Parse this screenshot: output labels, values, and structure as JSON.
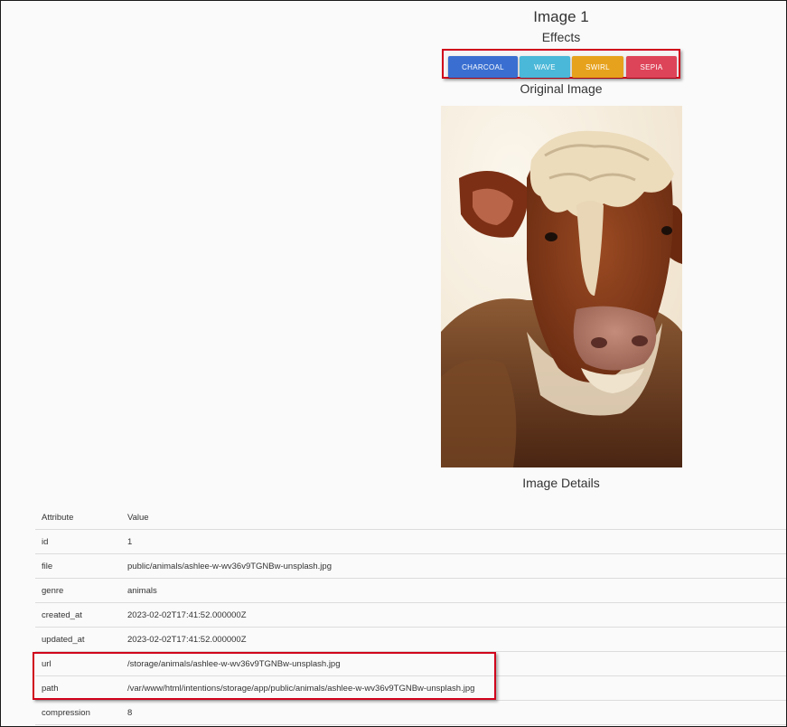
{
  "page": {
    "title": "Image 1",
    "effects_heading": "Effects",
    "original_heading": "Original Image",
    "details_heading": "Image Details"
  },
  "effects": {
    "charcoal": "CHARCOAL",
    "wave": "WAVE",
    "swirl": "SWIRL",
    "sepia": "SEPIA"
  },
  "colors": {
    "charcoal": "#3a6fd1",
    "wave": "#4ab8d8",
    "swirl": "#e7a21d",
    "sepia": "#de4459",
    "highlight": "#d0021b"
  },
  "photo": {
    "subject": "cow-photo"
  },
  "table": {
    "headers": {
      "attribute": "Attribute",
      "value": "Value"
    },
    "rows": [
      {
        "attribute": "id",
        "value": "1"
      },
      {
        "attribute": "file",
        "value": "public/animals/ashlee-w-wv36v9TGNBw-unsplash.jpg"
      },
      {
        "attribute": "genre",
        "value": "animals"
      },
      {
        "attribute": "created_at",
        "value": "2023-02-02T17:41:52.000000Z"
      },
      {
        "attribute": "updated_at",
        "value": "2023-02-02T17:41:52.000000Z"
      },
      {
        "attribute": "url",
        "value": "/storage/animals/ashlee-w-wv36v9TGNBw-unsplash.jpg"
      },
      {
        "attribute": "path",
        "value": "/var/www/html/intentions/storage/app/public/animals/ashlee-w-wv36v9TGNBw-unsplash.jpg"
      },
      {
        "attribute": "compression",
        "value": "8"
      }
    ]
  }
}
